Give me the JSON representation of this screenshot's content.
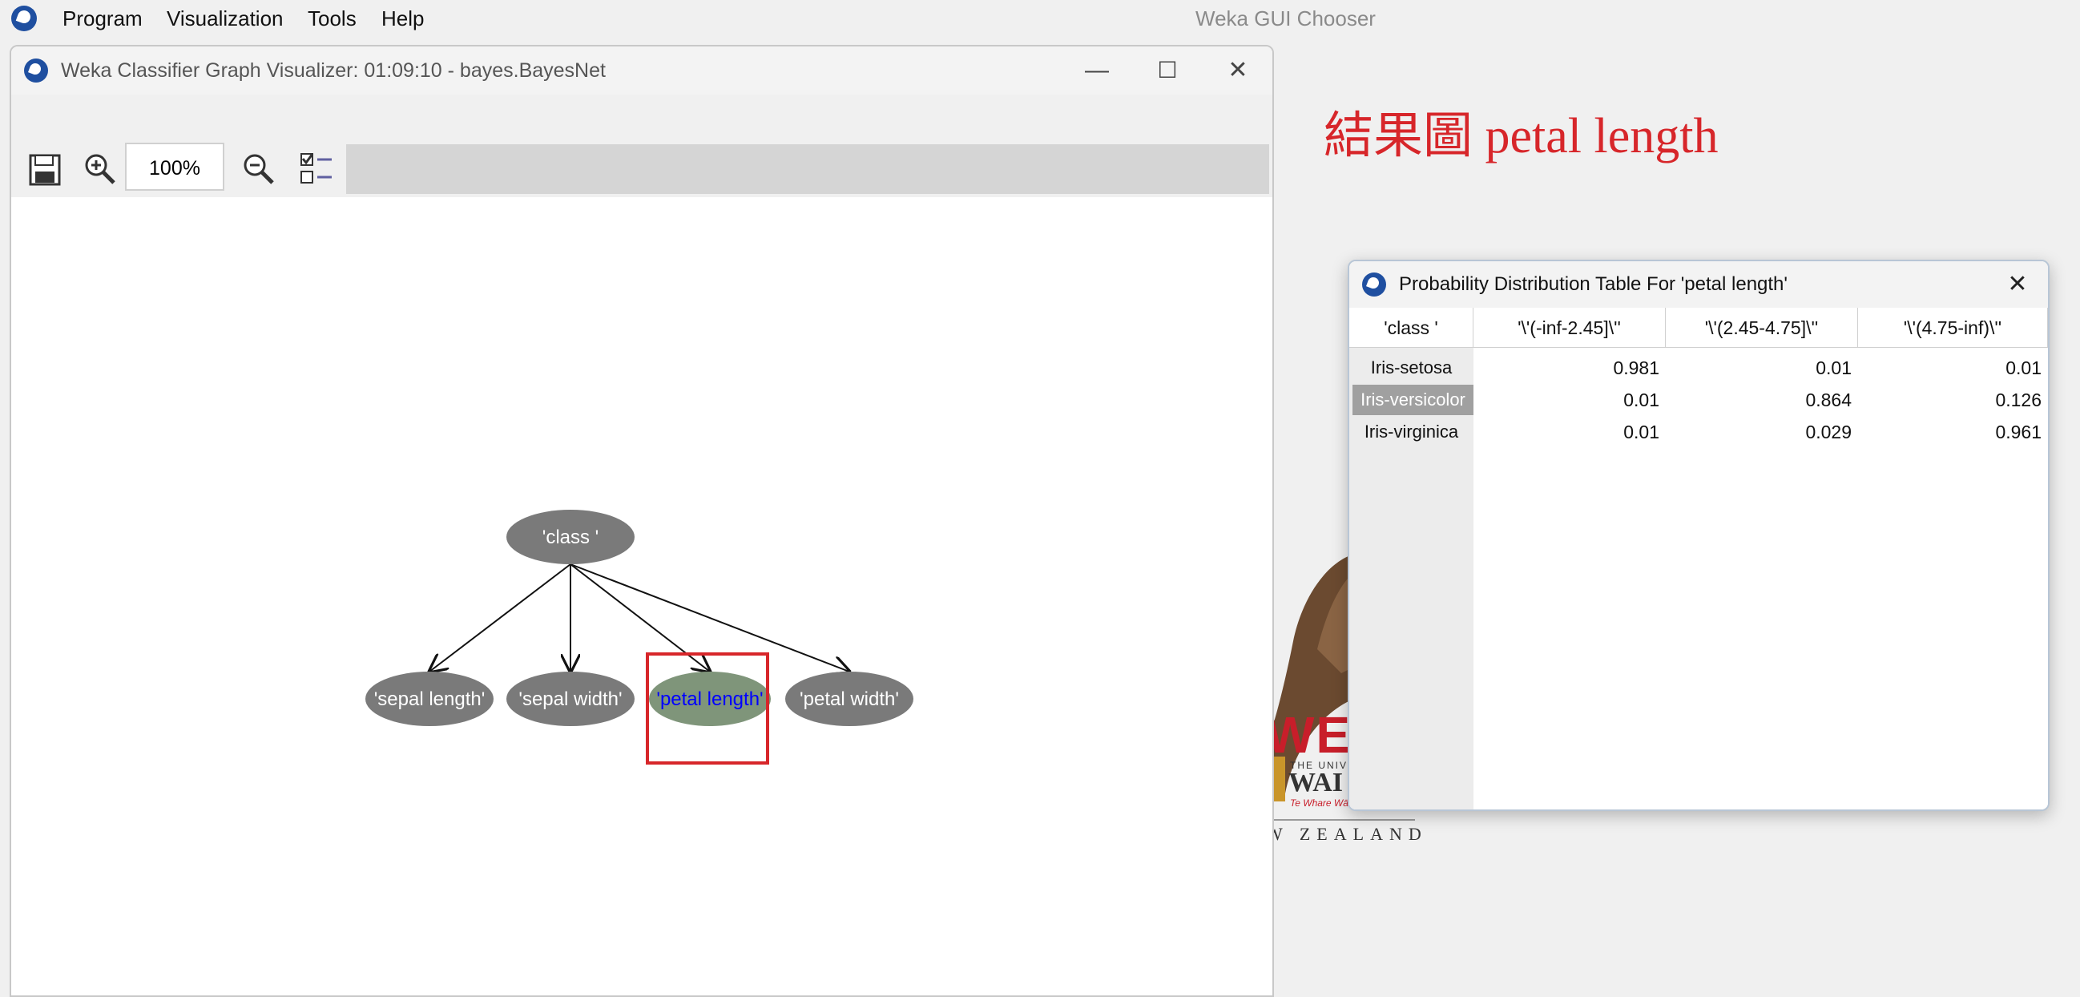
{
  "menubar": {
    "items": [
      "Program",
      "Visualization",
      "Tools",
      "Help"
    ],
    "chooser_title": "Weka GUI Chooser"
  },
  "graph_window": {
    "title": "Weka Classifier Graph Visualizer: 01:09:10 - bayes.BayesNet",
    "controls": {
      "minimize": "—",
      "maximize": "☐",
      "close": "✕"
    },
    "toolbar": {
      "save_icon": "save-icon",
      "zoom_in_icon": "zoom-in-icon",
      "zoom_value": "100%",
      "zoom_out_icon": "zoom-out-icon",
      "options_icon": "checklist-icon"
    },
    "graph": {
      "root": "'class '",
      "children": [
        "'sepal length'",
        "'sepal width'",
        "'petal length'",
        "'petal width'"
      ],
      "selected": "'petal length'",
      "node_color": "#7a7a7a",
      "selected_node_color": "#7f957a",
      "selected_text_color": "#0000ff",
      "highlight_box_color": "#d7262a"
    }
  },
  "annotation": "結果圖 petal length",
  "splash": {
    "brand_partial": "WE",
    "univ_partial": "THE UNIV",
    "wai_partial": "WAI",
    "motto_partial": "Te Whare Wā",
    "nz_partial": "W ZEALAND"
  },
  "prob_window": {
    "title": "Probability Distribution Table For 'petal length'",
    "close": "✕",
    "columns": [
      "'class '",
      "'\\'(-inf-2.45]\\''",
      "'\\'(2.45-4.75]\\''",
      "'\\'(4.75-inf)\\''"
    ],
    "rows": [
      {
        "label": "Iris-setosa",
        "values": [
          "0.981",
          "0.01",
          "0.01"
        ]
      },
      {
        "label": "Iris-versicolor",
        "values": [
          "0.01",
          "0.864",
          "0.126"
        ]
      },
      {
        "label": "Iris-virginica",
        "values": [
          "0.01",
          "0.029",
          "0.961"
        ]
      }
    ],
    "selected_row": "Iris-versicolor"
  }
}
